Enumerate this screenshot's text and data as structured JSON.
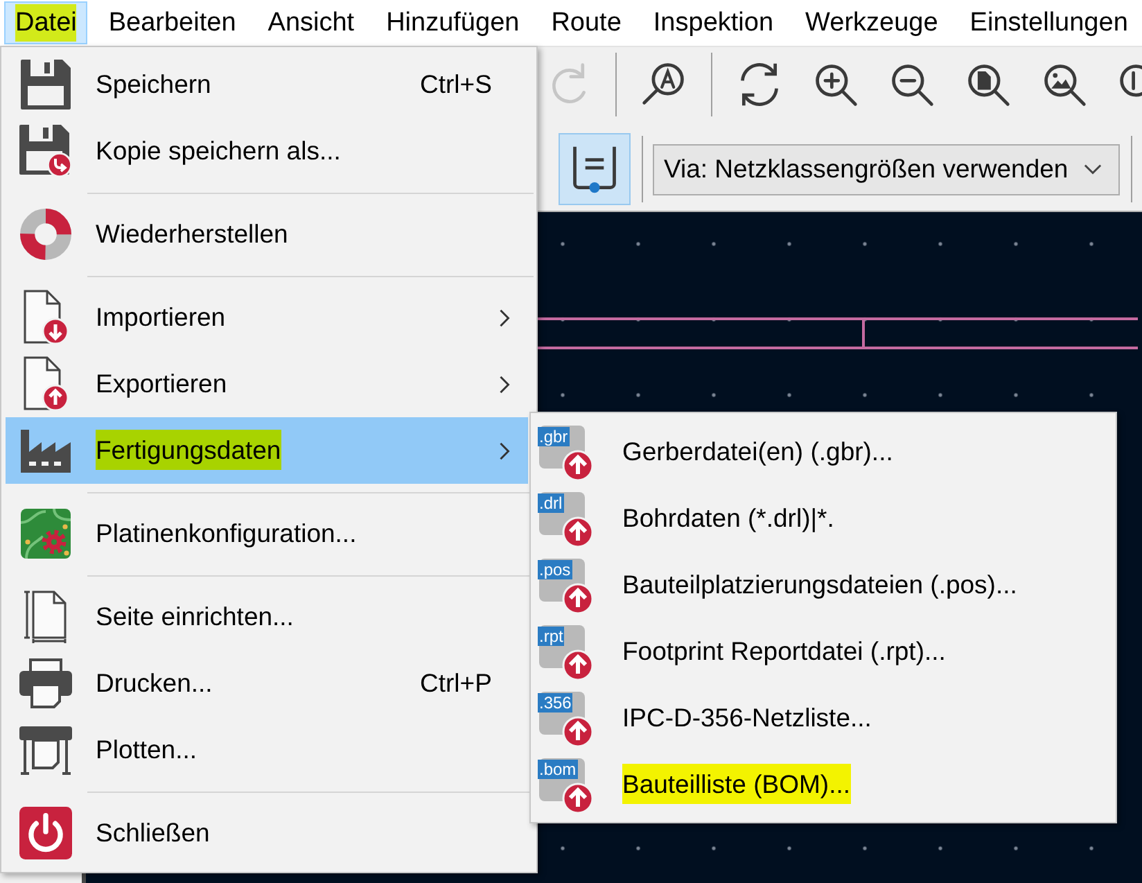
{
  "menu_bar": {
    "items": [
      {
        "label": "Datei",
        "selected": true,
        "highlighted": true
      },
      {
        "label": "Bearbeiten",
        "selected": false,
        "highlighted": false
      },
      {
        "label": "Ansicht",
        "selected": false,
        "highlighted": false
      },
      {
        "label": "Hinzufügen",
        "selected": false,
        "highlighted": false
      },
      {
        "label": "Route",
        "selected": false,
        "highlighted": false
      },
      {
        "label": "Inspektion",
        "selected": false,
        "highlighted": false
      },
      {
        "label": "Werkzeuge",
        "selected": false,
        "highlighted": false
      },
      {
        "label": "Einstellungen",
        "selected": false,
        "highlighted": false
      }
    ]
  },
  "toolbar": {
    "row_1": {
      "groups": [
        [
          {
            "kind": "redo",
            "disabled": true
          }
        ],
        [
          {
            "kind": "find",
            "disabled": false
          }
        ],
        [
          {
            "kind": "refresh",
            "disabled": false
          },
          {
            "kind": "zoomin",
            "disabled": false
          },
          {
            "kind": "zoomout",
            "disabled": false
          },
          {
            "kind": "zoompage",
            "disabled": false
          },
          {
            "kind": "zoomimage",
            "disabled": false
          },
          {
            "kind": "zoomcut",
            "disabled": false
          }
        ]
      ]
    },
    "row_2": {
      "via_button": {
        "selected": true
      },
      "via_dropdown": {
        "value": "Via: Netzklassengrößen verwenden"
      }
    }
  },
  "file_menu": {
    "items": [
      {
        "kind": "command",
        "label": "Speichern",
        "shortcut": "Ctrl+S",
        "submenu": false,
        "selected": false,
        "highlighted": false
      },
      {
        "kind": "command",
        "label": "Kopie speichern als...",
        "submenu": false,
        "selected": false,
        "highlighted": false
      },
      {
        "kind": "separator"
      },
      {
        "kind": "command",
        "label": "Wiederherstellen",
        "submenu": false,
        "selected": false,
        "highlighted": false
      },
      {
        "kind": "separator"
      },
      {
        "kind": "command",
        "label": "Importieren",
        "submenu": true,
        "selected": false,
        "highlighted": false
      },
      {
        "kind": "command",
        "label": "Exportieren",
        "submenu": true,
        "selected": false,
        "highlighted": false
      },
      {
        "kind": "command",
        "label": "Fertigungsdaten",
        "submenu": true,
        "selected": true,
        "highlighted": true
      },
      {
        "kind": "separator"
      },
      {
        "kind": "command",
        "label": "Platinenkonfiguration...",
        "submenu": false,
        "selected": false,
        "highlighted": false
      },
      {
        "kind": "separator"
      },
      {
        "kind": "command",
        "label": "Seite einrichten...",
        "submenu": false,
        "selected": false,
        "highlighted": false
      },
      {
        "kind": "command",
        "label": "Drucken...",
        "shortcut": "Ctrl+P",
        "submenu": false,
        "selected": false,
        "highlighted": false
      },
      {
        "kind": "command",
        "label": "Plotten...",
        "submenu": false,
        "selected": false,
        "highlighted": false
      },
      {
        "kind": "separator"
      },
      {
        "kind": "command",
        "label": "Schließen",
        "submenu": false,
        "selected": false,
        "highlighted": false
      }
    ]
  },
  "submenu": {
    "items": [
      {
        "icon_label": ".gbr",
        "label": "Gerberdatei(en) (.gbr)...",
        "highlighted": false
      },
      {
        "icon_label": ".drl",
        "label": "Bohrdaten (*.drl)|*.",
        "highlighted": false
      },
      {
        "icon_label": ".pos",
        "label": "Bauteilplatzierungsdateien (.pos)...",
        "highlighted": false
      },
      {
        "icon_label": ".rpt",
        "label": "Footprint Reportdatei (.rpt)...",
        "highlighted": false
      },
      {
        "icon_label": ".356",
        "label": "IPC-D-356-Netzliste...",
        "highlighted": false
      },
      {
        "icon_label": ".bom",
        "label": "Bauteilliste (BOM)...",
        "highlighted": true
      }
    ]
  }
}
